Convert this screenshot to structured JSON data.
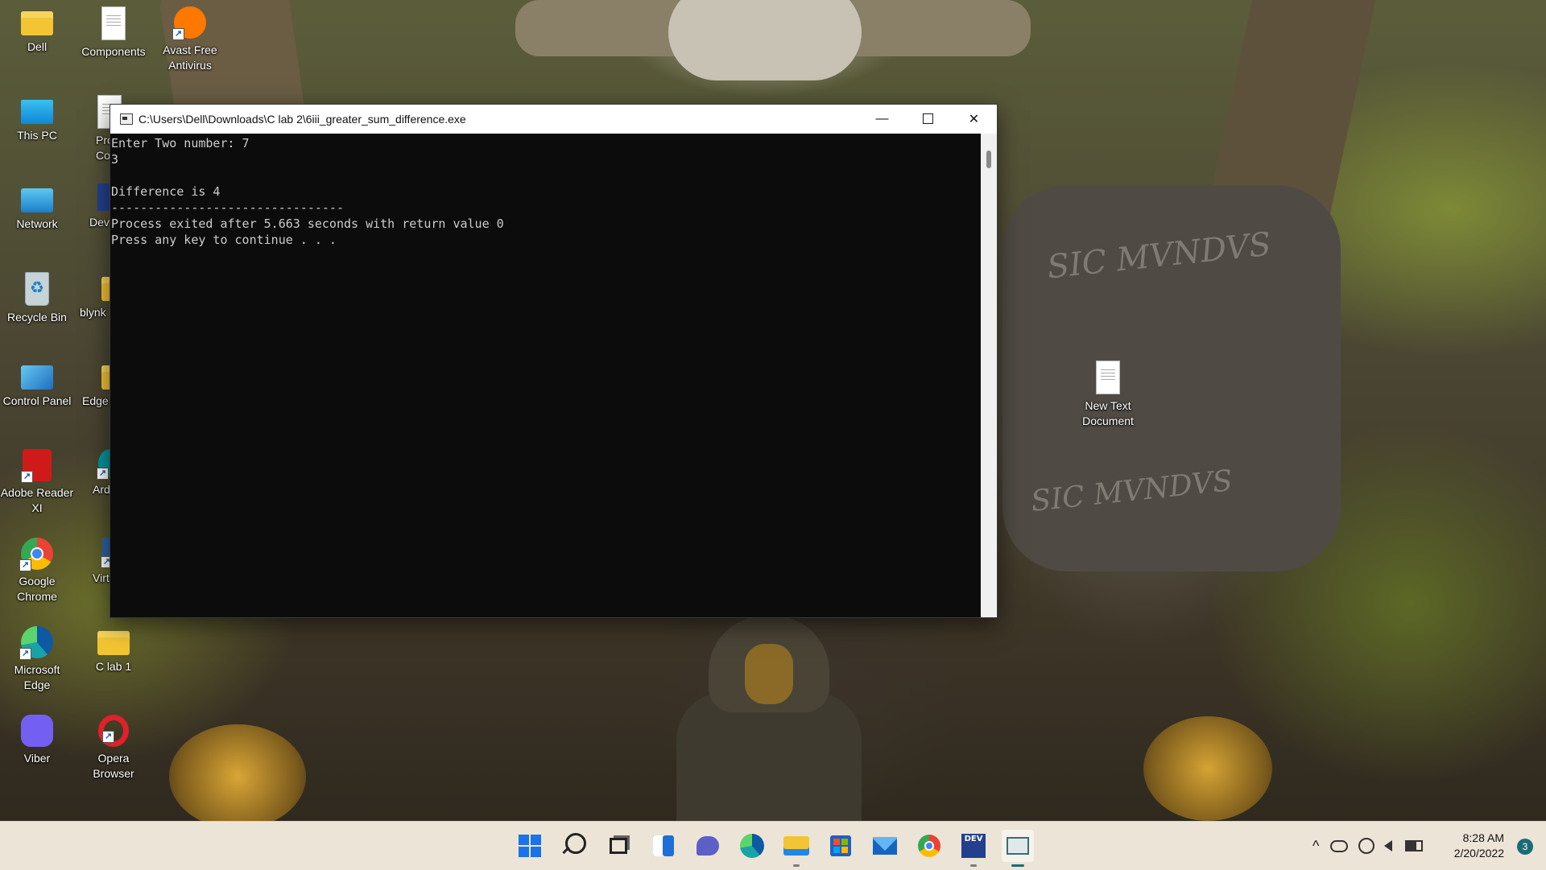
{
  "desktop": {
    "col1": [
      {
        "label": "Dell",
        "icon": "folder-icon"
      },
      {
        "label": "This PC",
        "icon": "monitor-icon"
      },
      {
        "label": "Network",
        "icon": "network-icon"
      },
      {
        "label": "Recycle Bin",
        "icon": "recycle-bin-icon"
      },
      {
        "label": "Control Panel",
        "icon": "control-panel-icon"
      },
      {
        "label": "Adobe Reader XI",
        "icon": "adobe-reader-icon"
      },
      {
        "label": "Google Chrome",
        "icon": "chrome-icon"
      },
      {
        "label": "Microsoft Edge",
        "icon": "edge-icon"
      },
      {
        "label": "Viber",
        "icon": "viber-icon"
      }
    ],
    "col2": [
      {
        "label": "Components",
        "icon": "text-document-icon"
      },
      {
        "label": "Pro Comp",
        "icon": "text-document-icon"
      },
      {
        "label": "Dev",
        "icon": "dev-cpp-icon"
      },
      {
        "label": "blynk",
        "icon": "folder-icon"
      },
      {
        "label": "Edge",
        "icon": "folder-icon"
      },
      {
        "label": "Ard",
        "icon": "arduino-icon"
      },
      {
        "label": "Virtu",
        "icon": "virtual-icon"
      },
      {
        "label": "C lab 1",
        "icon": "folder-icon"
      },
      {
        "label": "Opera Browser",
        "icon": "opera-icon"
      }
    ],
    "avast": {
      "label": "Avast Free Antivirus",
      "icon": "avast-icon"
    },
    "new_text": {
      "label": "New Text Document",
      "icon": "text-document-icon"
    }
  },
  "window": {
    "title": "C:\\Users\\Dell\\Downloads\\C lab 2\\6iii_greater_sum_difference.exe",
    "minimize": "—",
    "maximize": "☐",
    "close": "✕",
    "console_text": "Enter Two number: 7\n3\n\nDifference is 4\n--------------------------------\nProcess exited after 5.663 seconds with return value 0\nPress any key to continue . . ."
  },
  "taskbar": {
    "apps": [
      {
        "name": "start-button",
        "icon": "windows-logo-icon",
        "color": "#1a73e8"
      },
      {
        "name": "search-button",
        "icon": "search-icon",
        "color": "#222222"
      },
      {
        "name": "task-view-button",
        "icon": "task-view-icon",
        "color": "#222222"
      },
      {
        "name": "widgets-button",
        "icon": "widgets-icon",
        "color": "#1f6fd6"
      },
      {
        "name": "teams-chat-button",
        "icon": "chat-icon",
        "color": "#5b5fc7"
      },
      {
        "name": "edge-button",
        "icon": "edge-icon",
        "color": "#1aa3a7"
      },
      {
        "name": "file-explorer-button",
        "icon": "folder-icon",
        "color": "#f3c433"
      },
      {
        "name": "store-button",
        "icon": "store-icon",
        "color": "#1f5fc6"
      },
      {
        "name": "mail-button",
        "icon": "mail-icon",
        "color": "#1565c0"
      },
      {
        "name": "chrome-button",
        "icon": "chrome-icon",
        "color": "#34a853"
      },
      {
        "name": "dev-cpp-button",
        "icon": "dev-cpp-icon",
        "color": "#23408e"
      },
      {
        "name": "console-app-button",
        "icon": "console-icon",
        "color": "#3b6e6e"
      }
    ],
    "tray": {
      "chevron": "^",
      "time": "8:28 AM",
      "date": "2/20/2022",
      "notifications": "3"
    }
  }
}
